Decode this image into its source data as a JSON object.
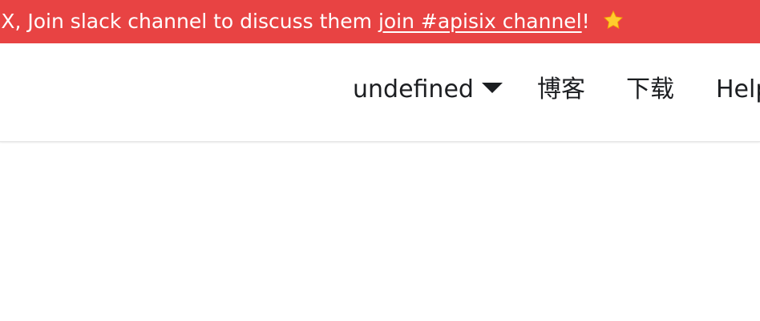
{
  "announcement": {
    "text_before": "IX, Join slack channel to discuss them ",
    "link_text": "join #apisix channel",
    "text_after": "!",
    "star_icon": "star-icon",
    "background_color": "#e84343"
  },
  "navbar": {
    "items": [
      {
        "label": "undefined",
        "has_caret": true
      },
      {
        "label": "博客"
      },
      {
        "label": "下载"
      },
      {
        "label": "Help"
      }
    ]
  }
}
